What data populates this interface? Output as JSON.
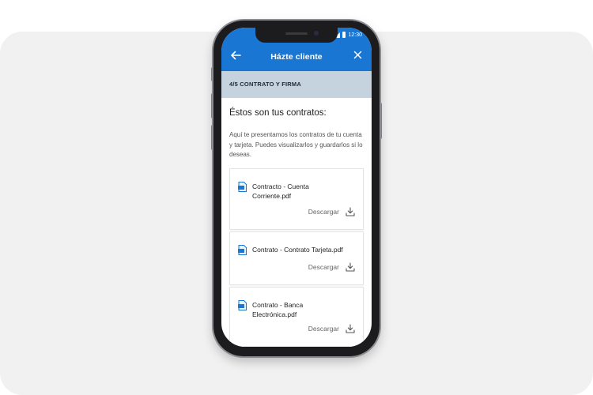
{
  "status_bar": {
    "time": "12:30"
  },
  "app_bar": {
    "title": "Házte cliente"
  },
  "step": {
    "label": "4/5 CONTRATO Y FIRMA"
  },
  "content": {
    "heading": "Éstos son tus contratos:",
    "description": "Aquí te presentamos los contratos de tu cuenta y tarjeta. Puedes visualizarlos y guardarlos si lo deseas."
  },
  "documents": [
    {
      "name": "Contracto - Cuenta Corriente.pdf",
      "action": "Descargar",
      "icon": "pdf-file-icon"
    },
    {
      "name": "Contrato - Contrato Tarjeta.pdf",
      "action": "Descargar",
      "icon": "pdf-file-icon"
    },
    {
      "name": "Contrato - Banca Electrónica.pdf",
      "action": "Descargar",
      "icon": "pdf-file-icon"
    }
  ],
  "colors": {
    "accent": "#1976d2",
    "step_bar": "#c4d3de",
    "backdrop": "#f1f1f1"
  }
}
